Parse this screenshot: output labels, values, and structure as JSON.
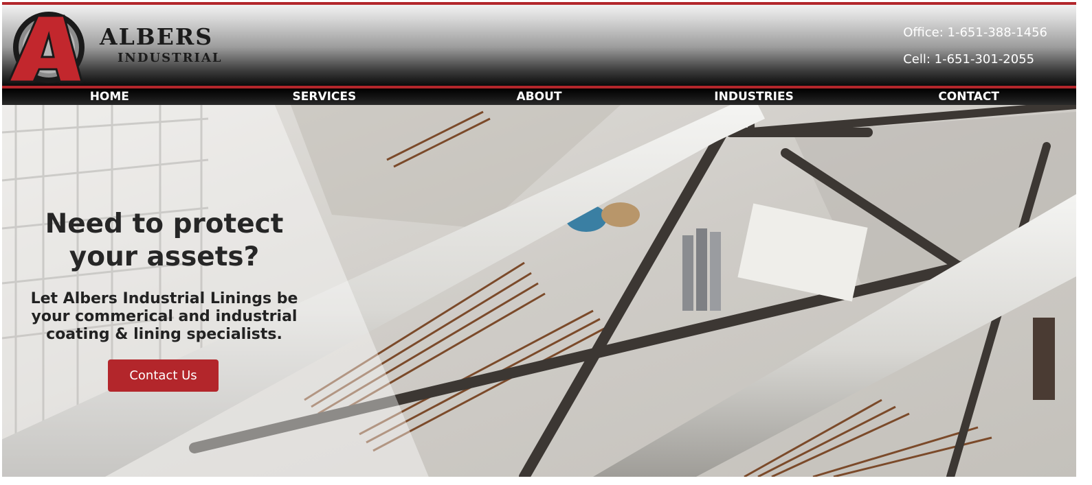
{
  "brand": {
    "logo_letter": "A",
    "name_line_1": "ALBERS",
    "name_line_2": "INDUSTRIAL"
  },
  "contact": {
    "office": "Office: 1-651-388-1456",
    "cell": "Cell: 1-651-301-2055"
  },
  "nav": {
    "items": [
      {
        "label": "HOME"
      },
      {
        "label": "SERVICES"
      },
      {
        "label": "ABOUT"
      },
      {
        "label": "INDUSTRIES"
      },
      {
        "label": "CONTACT"
      }
    ]
  },
  "hero": {
    "title": "Need to protect your assets?",
    "subtitle": "Let Albers Industrial Linings be your commerical and industrial coating & lining specialists.",
    "cta_label": "Contact Us"
  },
  "colors": {
    "brand_red": "#b3262b",
    "header_dark": "#0b0b0b",
    "nav_text": "#ffffff"
  }
}
